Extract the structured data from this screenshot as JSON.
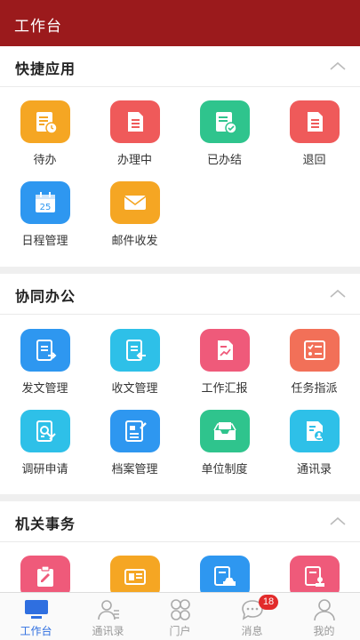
{
  "header": {
    "title": "工作台"
  },
  "sections": [
    {
      "title": "快捷应用",
      "items": [
        {
          "label": "待办",
          "icon": "todo-icon",
          "color": "#f5a623"
        },
        {
          "label": "办理中",
          "icon": "in-progress-doc-icon",
          "color": "#ef5a5a"
        },
        {
          "label": "已办结",
          "icon": "completed-doc-icon",
          "color": "#2fc48d"
        },
        {
          "label": "退回",
          "icon": "returned-doc-icon",
          "color": "#ef5a5a"
        },
        {
          "label": "日程管理",
          "icon": "calendar-icon",
          "color": "#2e97f0",
          "text": "25"
        },
        {
          "label": "邮件收发",
          "icon": "mail-icon",
          "color": "#f5a623"
        }
      ]
    },
    {
      "title": "协同办公",
      "items": [
        {
          "label": "发文管理",
          "icon": "send-doc-icon",
          "color": "#2e97f0"
        },
        {
          "label": "收文管理",
          "icon": "receive-doc-icon",
          "color": "#2ec0e8"
        },
        {
          "label": "工作汇报",
          "icon": "work-report-icon",
          "color": "#ef5a7a"
        },
        {
          "label": "任务指派",
          "icon": "task-assign-icon",
          "color": "#f27058"
        },
        {
          "label": "调研申请",
          "icon": "research-apply-icon",
          "color": "#2ec0e8"
        },
        {
          "label": "档案管理",
          "icon": "archive-icon",
          "color": "#2e97f0"
        },
        {
          "label": "单位制度",
          "icon": "inbox-tray-icon",
          "color": "#2fc48d"
        },
        {
          "label": "通讯录",
          "icon": "contacts-card-icon",
          "color": "#2ec0e8"
        }
      ]
    },
    {
      "title": "机关事务",
      "items": [
        {
          "label": "",
          "icon": "edit-form-icon",
          "color": "#ef5a7a"
        },
        {
          "label": "",
          "icon": "id-card-icon",
          "color": "#f5a623"
        },
        {
          "label": "",
          "icon": "vehicle-doc-icon",
          "color": "#2e97f0"
        },
        {
          "label": "",
          "icon": "seal-doc-icon",
          "color": "#ef5a7a"
        }
      ]
    }
  ],
  "tabbar": [
    {
      "label": "工作台",
      "icon": "workbench-icon",
      "active": true
    },
    {
      "label": "通讯录",
      "icon": "contacts-icon",
      "active": false
    },
    {
      "label": "门户",
      "icon": "portal-icon",
      "active": false
    },
    {
      "label": "消息",
      "icon": "message-icon",
      "active": false,
      "badge": "18"
    },
    {
      "label": "我的",
      "icon": "profile-icon",
      "active": false
    }
  ],
  "colors": {
    "header": "#9b1a1c",
    "active_tab": "#2f6fe0",
    "badge": "#e22b2b"
  }
}
